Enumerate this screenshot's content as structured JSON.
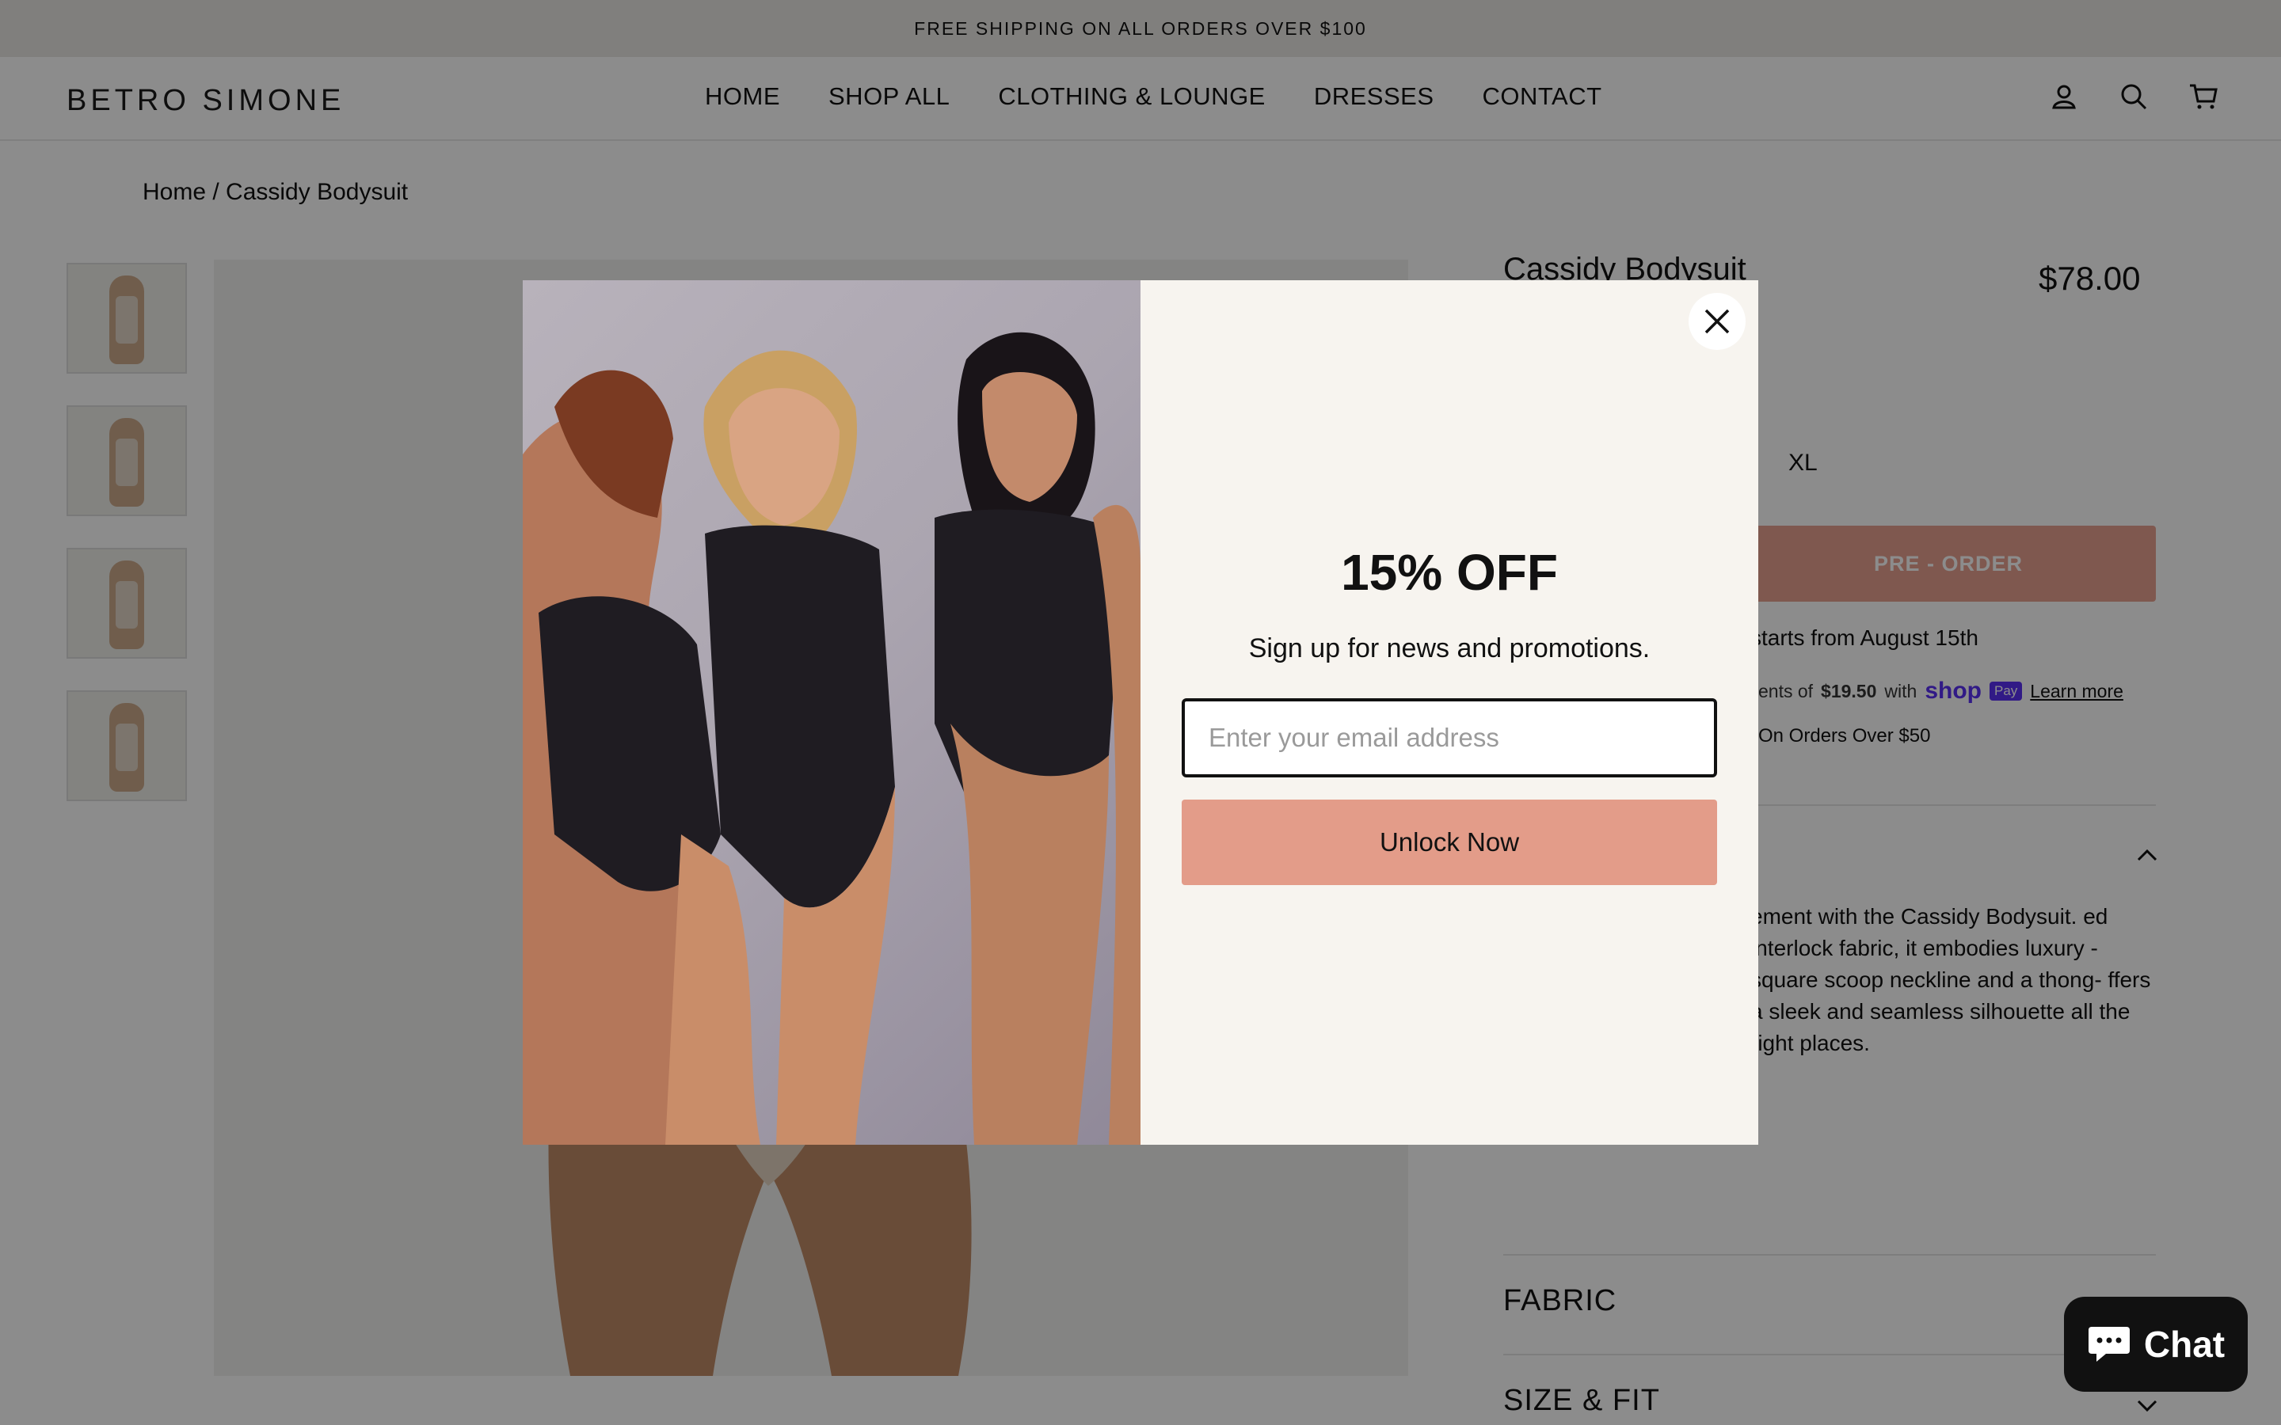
{
  "announcement": {
    "text": "FREE SHIPPING ON ALL ORDERS OVER $100"
  },
  "header": {
    "logo": "BETRO SIMONE",
    "nav": [
      "HOME",
      "SHOP ALL",
      "CLOTHING & LOUNGE",
      "DRESSES",
      "CONTACT"
    ],
    "icons": [
      "account-icon",
      "search-icon",
      "cart-icon"
    ]
  },
  "breadcrumb": "Home / Cassidy Bodysuit",
  "product": {
    "title": "Cassidy Bodysuit",
    "price": "$78.00",
    "visible_size": "XL",
    "preorder_label": "PRE - ORDER",
    "shipping_note": "starts from August 15th",
    "installments_prefix": "ents of",
    "installments_amount": "$19.50",
    "installments_with": "with",
    "shop_label": "shop",
    "pay_label": "Pay",
    "learn_more": "Learn more",
    "free_shipping_note": "On Orders Over $50",
    "description": "ement with the Cassidy Bodysuit. ed interlock fabric, it embodies luxury -square scoop neckline and a thong- ffers a sleek and seamless silhouette all the right places.",
    "accordions": [
      "FABRIC",
      "SIZE & FIT"
    ]
  },
  "modal": {
    "headline": "15% OFF",
    "subtext": "Sign up for news and promotions.",
    "email_placeholder": "Enter your email address",
    "email_value": "",
    "button_label": "Unlock Now"
  },
  "chat": {
    "label": "Chat"
  },
  "colors": {
    "accent": "#e39c89",
    "preorder": "#e8a190",
    "shoppay": "#5a31f4",
    "modal_bg": "#f7f4ef"
  }
}
